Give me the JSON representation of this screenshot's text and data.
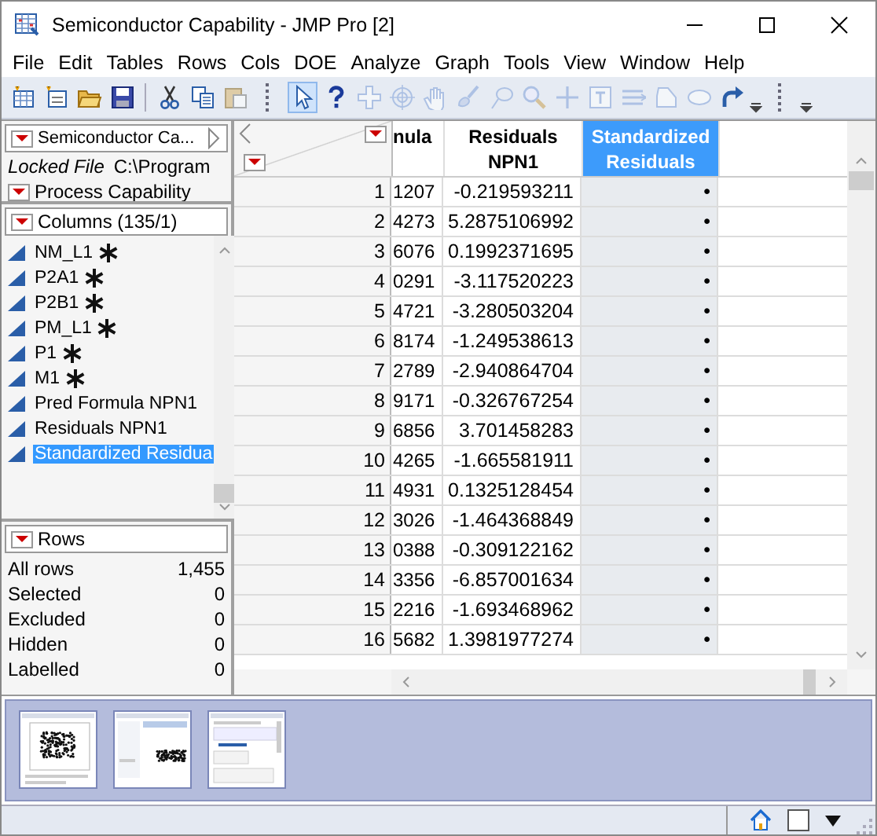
{
  "window": {
    "title": "Semiconductor Capability - JMP Pro [2]"
  },
  "menu": [
    "File",
    "Edit",
    "Tables",
    "Rows",
    "Cols",
    "DOE",
    "Analyze",
    "Graph",
    "Tools",
    "View",
    "Window",
    "Help"
  ],
  "toolbar": [
    {
      "kind": "new-table",
      "disabled": false,
      "selected": false
    },
    {
      "kind": "new-script",
      "disabled": false,
      "selected": false
    },
    {
      "kind": "open",
      "disabled": false,
      "selected": false
    },
    {
      "kind": "save",
      "disabled": false,
      "selected": false
    },
    {
      "kind": "cut",
      "disabled": false,
      "selected": false
    },
    {
      "kind": "copy",
      "disabled": false,
      "selected": false
    },
    {
      "kind": "paste",
      "disabled": true,
      "selected": false
    },
    {
      "kind": "arrow",
      "disabled": false,
      "selected": true
    },
    {
      "kind": "help",
      "disabled": false,
      "selected": false
    },
    {
      "kind": "crosshair",
      "disabled": true,
      "selected": false
    },
    {
      "kind": "target",
      "disabled": true,
      "selected": false
    },
    {
      "kind": "hand",
      "disabled": true,
      "selected": false
    },
    {
      "kind": "brush",
      "disabled": true,
      "selected": false
    },
    {
      "kind": "lasso",
      "disabled": true,
      "selected": false
    },
    {
      "kind": "magnifier",
      "disabled": true,
      "selected": false
    },
    {
      "kind": "plus",
      "disabled": true,
      "selected": false
    },
    {
      "kind": "text",
      "disabled": true,
      "selected": false
    },
    {
      "kind": "lines",
      "disabled": true,
      "selected": false
    },
    {
      "kind": "polygon",
      "disabled": true,
      "selected": false
    },
    {
      "kind": "ellipse",
      "disabled": true,
      "selected": false
    },
    {
      "kind": "redo",
      "disabled": false,
      "selected": false
    }
  ],
  "table_panel": {
    "title": "Semiconductor Ca...",
    "locked_label": "Locked File",
    "locked_path": "C:\\Program",
    "script": "Process Capability"
  },
  "columns_panel": {
    "title": "Columns (135/1)",
    "items": [
      {
        "name": "NM_L1",
        "formula": true,
        "selected": false
      },
      {
        "name": "P2A1",
        "formula": true,
        "selected": false
      },
      {
        "name": "P2B1",
        "formula": true,
        "selected": false
      },
      {
        "name": "PM_L1",
        "formula": true,
        "selected": false
      },
      {
        "name": "P1",
        "formula": true,
        "selected": false
      },
      {
        "name": "M1",
        "formula": true,
        "selected": false
      },
      {
        "name": "Pred Formula NPN1",
        "formula": false,
        "selected": false
      },
      {
        "name": "Residuals NPN1",
        "formula": false,
        "selected": false
      },
      {
        "name": "Standardized Residua",
        "formula": false,
        "selected": true
      }
    ]
  },
  "rows_panel": {
    "title": "Rows",
    "items": [
      {
        "label": "All rows",
        "value": "1,455"
      },
      {
        "label": "Selected",
        "value": "0"
      },
      {
        "label": "Excluded",
        "value": "0"
      },
      {
        "label": "Hidden",
        "value": "0"
      },
      {
        "label": "Labelled",
        "value": "0"
      }
    ]
  },
  "table": {
    "columns": [
      {
        "name": "nula",
        "selected": false
      },
      {
        "name": "Residuals NPN1",
        "selected": false
      },
      {
        "name": "Standardized Residuals",
        "selected": true
      }
    ],
    "rows": [
      {
        "n": "1",
        "cells": [
          "1207",
          "-0.219593211",
          "•"
        ]
      },
      {
        "n": "2",
        "cells": [
          "4273",
          "5.2875106992",
          "•"
        ]
      },
      {
        "n": "3",
        "cells": [
          "6076",
          "0.1992371695",
          "•"
        ]
      },
      {
        "n": "4",
        "cells": [
          "0291",
          "-3.117520223",
          "•"
        ]
      },
      {
        "n": "5",
        "cells": [
          "4721",
          "-3.280503204",
          "•"
        ]
      },
      {
        "n": "6",
        "cells": [
          "8174",
          "-1.249538613",
          "•"
        ]
      },
      {
        "n": "7",
        "cells": [
          "2789",
          "-2.940864704",
          "•"
        ]
      },
      {
        "n": "8",
        "cells": [
          "9171",
          "-0.326767254",
          "•"
        ]
      },
      {
        "n": "9",
        "cells": [
          "6856",
          "3.701458283",
          "•"
        ]
      },
      {
        "n": "10",
        "cells": [
          "4265",
          "-1.665581911",
          "•"
        ]
      },
      {
        "n": "11",
        "cells": [
          "4931",
          "0.1325128454",
          "•"
        ]
      },
      {
        "n": "12",
        "cells": [
          "3026",
          "-1.464368849",
          "•"
        ]
      },
      {
        "n": "13",
        "cells": [
          "0388",
          "-0.309122162",
          "•"
        ]
      },
      {
        "n": "14",
        "cells": [
          "3356",
          "-6.857001634",
          "•"
        ]
      },
      {
        "n": "15",
        "cells": [
          "2216",
          "-1.693468962",
          "•"
        ]
      },
      {
        "n": "16",
        "cells": [
          "5682",
          "1.3981977274",
          "•"
        ]
      }
    ]
  }
}
